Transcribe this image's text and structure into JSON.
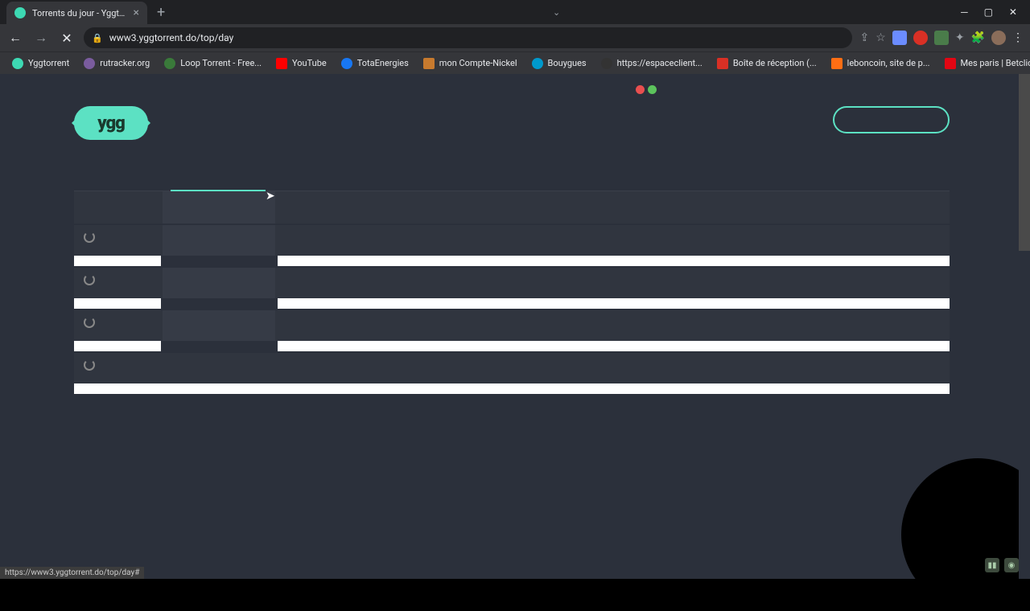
{
  "browser": {
    "tab_title": "Torrents du jour - Yggtorrent",
    "url": "www3.yggtorrent.do/top/day",
    "status_url": "https://www3.yggtorrent.do/top/day#"
  },
  "bookmarks": [
    {
      "label": "Yggtorrent",
      "color": "#3dd9b3"
    },
    {
      "label": "rutracker.org",
      "color": "#7a5c9e"
    },
    {
      "label": "Loop Torrent - Free...",
      "color": "#3a7a3a"
    },
    {
      "label": "YouTube",
      "color": "#ff0000"
    },
    {
      "label": "TotaEnergies",
      "color": "#1877f2"
    },
    {
      "label": "mon Compte-Nickel",
      "color": "#c77a2e"
    },
    {
      "label": "Bouygues",
      "color": "#0099cc"
    },
    {
      "label": "https://espaceclient...",
      "color": "#333333"
    },
    {
      "label": "Boîte de réception (...",
      "color": "#d93025"
    },
    {
      "label": "leboncoin, site de p...",
      "color": "#ff6e14"
    },
    {
      "label": "Mes paris | Betclic",
      "color": "#e30613"
    }
  ],
  "logo": {
    "text": "ygg"
  },
  "colors": {
    "accent": "#5ce1c3",
    "page_bg": "#2b303b",
    "row_dark": "#30353f",
    "row_light": "#ffffff"
  }
}
